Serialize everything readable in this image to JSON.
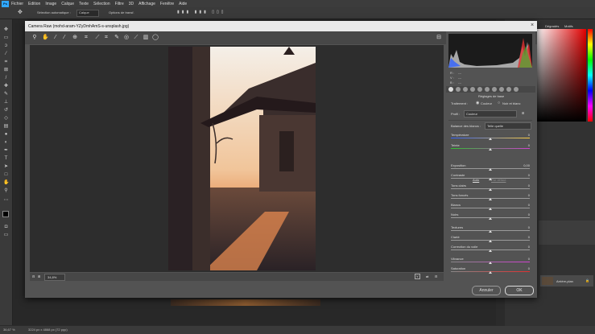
{
  "app": {
    "menu": [
      "Fichier",
      "Edition",
      "Image",
      "Calque",
      "Texte",
      "Sélection",
      "Filtre",
      "3D",
      "Affichage",
      "Fenêtre",
      "Aide"
    ],
    "options": {
      "select_label": "Sélection automatique :",
      "select_value": "Calque",
      "transform_label": "Options de transf."
    }
  },
  "status": {
    "zoom": "36,67 %",
    "doc_info": "3224 px x 4868 px (72 ppp)"
  },
  "right_panels": {
    "tab1": "Dégradés",
    "tab2": "Motifs",
    "layer_name": "Arrière-plan"
  },
  "dialog": {
    "title": "Camera Raw (mohd-aram-YZyDmhAmS-s-unsplash.jpg)",
    "zoom": "34,8%",
    "buttons": {
      "cancel": "Annuler",
      "ok": "OK"
    },
    "rgb": {
      "r_label": "R :",
      "g_label": "V :",
      "b_label": "B :",
      "r": "---",
      "g": "---",
      "b": "---"
    },
    "panel": {
      "title": "Réglages de base",
      "treatment_label": "Traitement :",
      "color_option": "Couleur",
      "bw_option": "Noir et blanc",
      "profile_label": "Profil :",
      "profile_value": "Couleur",
      "wb_label": "Balance des blancs :",
      "wb_value": "Telle quelle",
      "auto": "Auto",
      "default": "Par défaut",
      "sliders": [
        {
          "label": "Température",
          "value": "0"
        },
        {
          "label": "Teinte",
          "value": "0"
        },
        {
          "label": "Exposition",
          "value": "0,00"
        },
        {
          "label": "Contraste",
          "value": "0"
        },
        {
          "label": "Tons clairs",
          "value": "0"
        },
        {
          "label": "Tons foncés",
          "value": "0"
        },
        {
          "label": "Blancs",
          "value": "0"
        },
        {
          "label": "Noirs",
          "value": "0"
        },
        {
          "label": "Textures",
          "value": "0"
        },
        {
          "label": "Clarté",
          "value": "0"
        },
        {
          "label": "Correction du voile",
          "value": "0"
        },
        {
          "label": "Vibrance",
          "value": "0"
        },
        {
          "label": "Saturation",
          "value": "0"
        }
      ]
    }
  }
}
